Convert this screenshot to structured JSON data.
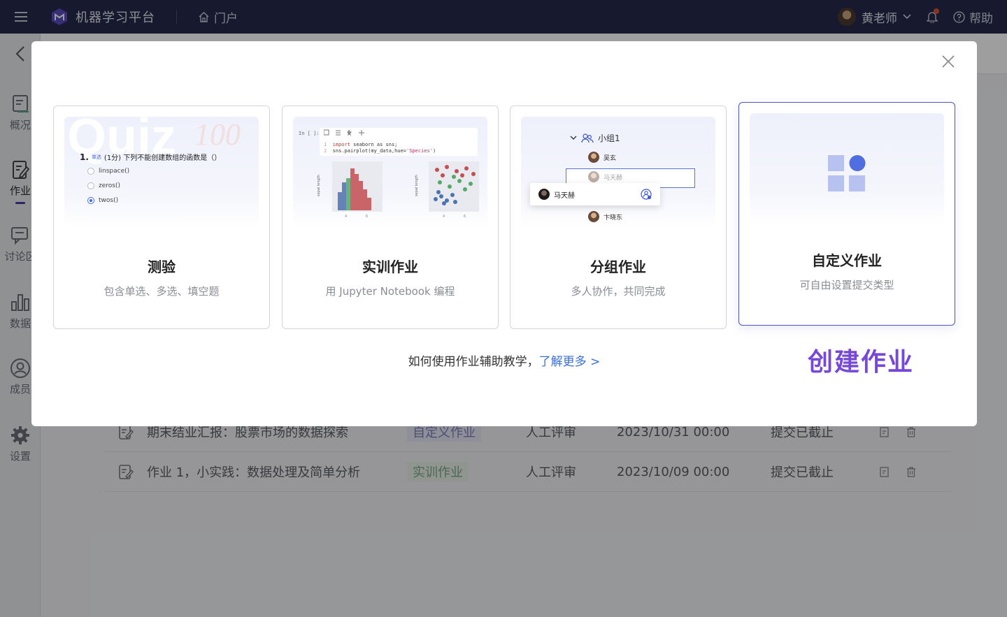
{
  "topbar": {
    "app_title": "机器学习平台",
    "portal_label": "门户",
    "user_name": "黄老师",
    "help_label": "帮助",
    "has_notification": true
  },
  "sidebar": {
    "items": [
      {
        "label": "概况",
        "icon": "overview-icon"
      },
      {
        "label": "作业",
        "icon": "assignment-icon",
        "active": true
      },
      {
        "label": "讨论区",
        "icon": "discussion-icon"
      },
      {
        "label": "数据",
        "icon": "data-chart-icon"
      },
      {
        "label": "成员",
        "icon": "member-icon"
      },
      {
        "label": "设置",
        "icon": "gear-icon"
      }
    ]
  },
  "background_table": {
    "rows": [
      {
        "title": "期末结业汇报：股票市场的数据探索",
        "type": "自定义作业",
        "review": "人工评审",
        "deadline": "2023/10/31 00:00",
        "status": "提交已截止"
      },
      {
        "title": "作业 1，小实践：数据处理及简单分析",
        "type": "实训作业",
        "review": "人工评审",
        "deadline": "2023/10/09 00:00",
        "status": "提交已截止"
      }
    ]
  },
  "modal": {
    "cards": [
      {
        "title": "测验",
        "subtitle": "包含单选、多选、填空题"
      },
      {
        "title": "实训作业",
        "subtitle": "用 Jupyter Notebook 编程"
      },
      {
        "title": "分组作业",
        "subtitle": "多人协作，共同完成"
      },
      {
        "title": "自定义作业",
        "subtitle": "可自由设置提交类型",
        "selected": true
      }
    ],
    "hint_text": "如何使用作业辅助教学，",
    "learn_more": "了解更多 >",
    "create_label": "创建作业"
  },
  "quiz_preview": {
    "watermark": "Quiz",
    "score": "100",
    "question_number": "1.",
    "question_tag": "单选",
    "question_text": "(1分) 下列不能创建数组的函数是（）",
    "options": [
      "linspace()",
      "zeros()",
      "twos()"
    ],
    "selected_option": 2
  },
  "jupyter_preview": {
    "in_label": "In [ ]:",
    "line1_kw": "import",
    "line1_rest": " seaborn as sns;",
    "line2_pre": "sns.pairplot(my_data,hue=",
    "line2_str": "'Species'",
    "line2_end": ")",
    "axis_label": "sepal length"
  },
  "group_preview": {
    "group_name": "小组1",
    "members": [
      "吴玄",
      "马天赫",
      "卞晓东"
    ],
    "dragging": "马天赫"
  },
  "colors": {
    "topbar_bg": "#262b4d",
    "accent": "#4b55c8",
    "create_label": "#7548d8",
    "link": "#3b6fd8"
  }
}
